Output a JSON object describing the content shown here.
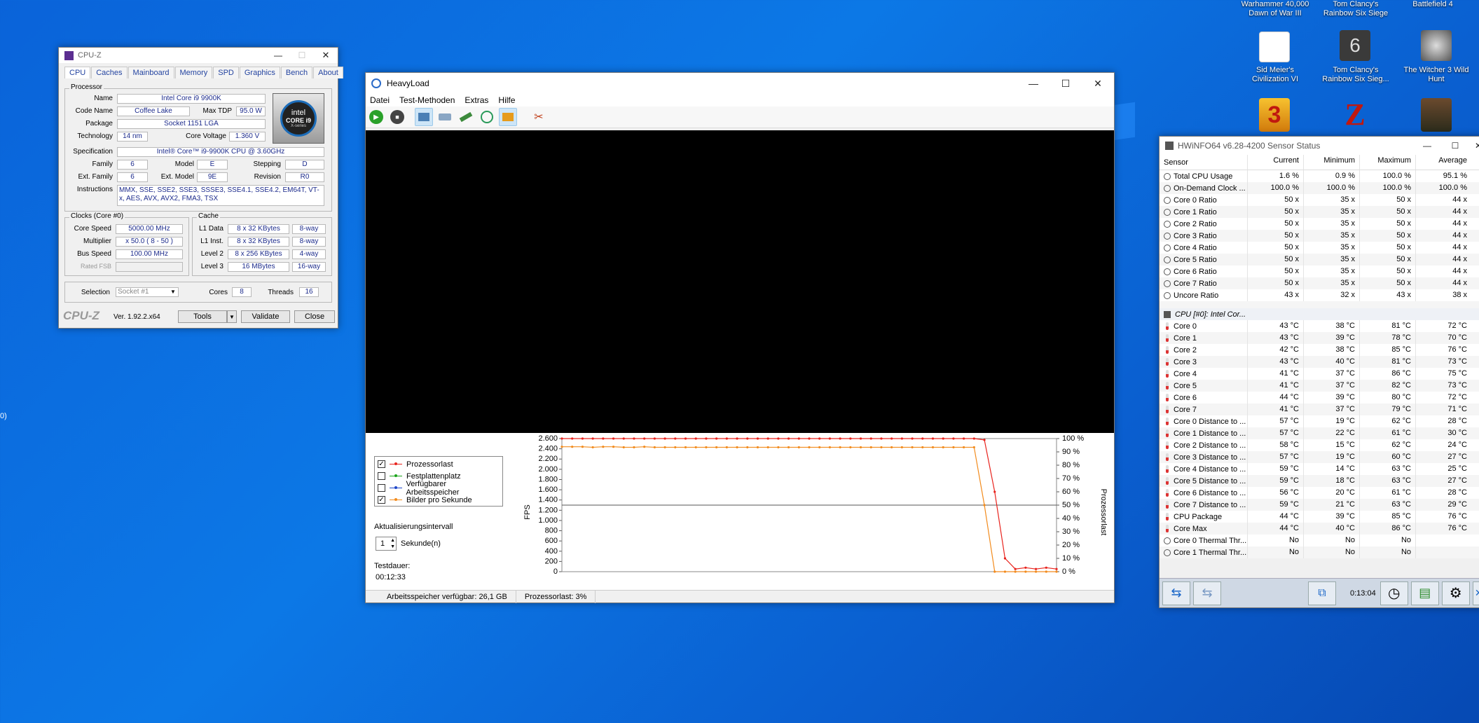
{
  "desktop": {
    "icons": [
      {
        "label_line1": "Warhammer 40,000",
        "label_line2": "Dawn of War III"
      },
      {
        "label_line1": "Tom Clancy's",
        "label_line2": "Rainbow Six Siege"
      },
      {
        "label_line1": "Battlefield 4",
        "label_line2": ""
      },
      {
        "label_line1": "Sid Meier's",
        "label_line2": "Civilization VI"
      },
      {
        "label_line1": "Tom Clancy's",
        "label_line2": "Rainbow Six Sieg..."
      },
      {
        "label_line1": "The Witcher 3 Wild",
        "label_line2": "Hunt"
      }
    ],
    "edge_text": "0)"
  },
  "cpuz": {
    "title": "CPU-Z",
    "tabs": [
      "CPU",
      "Caches",
      "Mainboard",
      "Memory",
      "SPD",
      "Graphics",
      "Bench",
      "About"
    ],
    "processor_group": "Processor",
    "labels": {
      "name": "Name",
      "code_name": "Code Name",
      "max_tdp": "Max TDP",
      "package": "Package",
      "technology": "Technology",
      "core_voltage": "Core Voltage",
      "specification": "Specification",
      "family": "Family",
      "model": "Model",
      "stepping": "Stepping",
      "ext_family": "Ext. Family",
      "ext_model": "Ext. Model",
      "revision": "Revision",
      "instructions": "Instructions"
    },
    "values": {
      "name": "Intel Core i9 9900K",
      "code_name": "Coffee Lake",
      "max_tdp": "95.0 W",
      "package": "Socket 1151 LGA",
      "technology": "14 nm",
      "core_voltage": "1.360 V",
      "specification": "Intel® Core™ i9-9900K CPU @ 3.60GHz",
      "family": "6",
      "model": "E",
      "stepping": "D",
      "ext_family": "6",
      "ext_model": "9E",
      "revision": "R0",
      "instructions": "MMX, SSE, SSE2, SSE3, SSSE3, SSE4.1, SSE4.2, EM64T, VT-x, AES, AVX, AVX2, FMA3, TSX"
    },
    "intel_logo": {
      "brand": "intel",
      "line1": "CORE i9",
      "line2": "X-series"
    },
    "clocks_group": "Clocks (Core #0)",
    "clocks": {
      "core_speed_label": "Core Speed",
      "core_speed": "5000.00 MHz",
      "multiplier_label": "Multiplier",
      "multiplier": "x 50.0 ( 8 - 50 )",
      "bus_speed_label": "Bus Speed",
      "bus_speed": "100.00 MHz",
      "rated_fsb_label": "Rated FSB",
      "rated_fsb": ""
    },
    "cache_group": "Cache",
    "cache": [
      {
        "label": "L1 Data",
        "size": "8 x 32 KBytes",
        "way": "8-way"
      },
      {
        "label": "L1 Inst.",
        "size": "8 x 32 KBytes",
        "way": "8-way"
      },
      {
        "label": "Level 2",
        "size": "8 x 256 KBytes",
        "way": "4-way"
      },
      {
        "label": "Level 3",
        "size": "16 MBytes",
        "way": "16-way"
      }
    ],
    "selection_label": "Selection",
    "selection_value": "Socket #1",
    "cores_label": "Cores",
    "cores": "8",
    "threads_label": "Threads",
    "threads": "16",
    "footer_brand": "CPU-Z",
    "version": "Ver. 1.92.2.x64",
    "tools_label": "Tools",
    "validate_label": "Validate",
    "close_label": "Close"
  },
  "heavyload": {
    "title": "HeavyLoad",
    "menu": [
      "Datei",
      "Test-Methoden",
      "Extras",
      "Hilfe"
    ],
    "legend": [
      {
        "label": "Prozessorlast",
        "checked": true,
        "color": "#e8231d"
      },
      {
        "label": "Festplattenplatz",
        "checked": false,
        "color": "#1aa31a"
      },
      {
        "label": "Verfügbarer Arbeitsspeicher",
        "checked": false,
        "color": "#1e46c8"
      },
      {
        "label": "Bilder pro Sekunde",
        "checked": true,
        "color": "#f28b1d"
      }
    ],
    "interval_label": "Aktualisierungsintervall",
    "interval_value": "1",
    "interval_unit": "Sekunde(n)",
    "duration_label": "Testdauer:",
    "duration_value": "00:12:33",
    "status": {
      "memory": "Arbeitsspeicher verfügbar: 26,1 GB",
      "cpu": "Prozessorlast: 3%"
    }
  },
  "chart_data": {
    "type": "line",
    "title": "",
    "xlabel": "",
    "ylabel": "FPS",
    "y2label": "Prozessorlast",
    "ylim": [
      0,
      2600
    ],
    "y2lim": [
      0,
      100
    ],
    "y_ticks": [
      "2.600",
      "2.400",
      "2.200",
      "2.000",
      "1.800",
      "1.600",
      "1.400",
      "1.200",
      "1.000",
      "800",
      "600",
      "400",
      "200",
      "0"
    ],
    "y2_ticks": [
      "100 %",
      "90 %",
      "80 %",
      "70 %",
      "60 %",
      "50 %",
      "40 %",
      "30 %",
      "20 %",
      "10 %",
      "0 %"
    ],
    "x": [
      0,
      1,
      2,
      3,
      4,
      5,
      6,
      7,
      8,
      9,
      10,
      11,
      12,
      13,
      14,
      15,
      16,
      17,
      18,
      19,
      20,
      21,
      22,
      23,
      24,
      25,
      26,
      27,
      28,
      29,
      30,
      31,
      32,
      33,
      34,
      35,
      36,
      37,
      38,
      39,
      40,
      41,
      42,
      43,
      44,
      45,
      46,
      47,
      48
    ],
    "series": [
      {
        "name": "Prozessorlast",
        "axis": "y2",
        "color": "#e8231d",
        "values": [
          100,
          100,
          100,
          100,
          100,
          100,
          100,
          100,
          100,
          100,
          100,
          100,
          100,
          100,
          100,
          100,
          100,
          100,
          100,
          100,
          100,
          100,
          100,
          100,
          100,
          100,
          100,
          100,
          100,
          100,
          100,
          100,
          100,
          100,
          100,
          100,
          100,
          100,
          100,
          100,
          100,
          99,
          60,
          10,
          2,
          3,
          2,
          3,
          2
        ]
      },
      {
        "name": "Bilder pro Sekunde",
        "axis": "y",
        "color": "#f28b1d",
        "values": [
          2440,
          2440,
          2440,
          2430,
          2440,
          2440,
          2430,
          2430,
          2440,
          2430,
          2430,
          2430,
          2430,
          2430,
          2430,
          2430,
          2430,
          2430,
          2430,
          2430,
          2430,
          2430,
          2430,
          2430,
          2430,
          2430,
          2430,
          2430,
          2430,
          2430,
          2430,
          2430,
          2430,
          2430,
          2430,
          2430,
          2430,
          2430,
          2430,
          2430,
          2430,
          1300,
          0,
          0,
          0,
          0,
          0,
          0,
          0
        ]
      }
    ],
    "grid": false,
    "legend": "left"
  },
  "hwinfo": {
    "title": "HWiNFO64 v6.28-4200 Sensor Status",
    "columns": [
      "Sensor",
      "Current",
      "Minimum",
      "Maximum",
      "Average"
    ],
    "rows1": [
      {
        "s": "Total CPU Usage",
        "c": "1.6 %",
        "mi": "0.9 %",
        "ma": "100.0 %",
        "av": "95.1 %"
      },
      {
        "s": "On-Demand Clock ...",
        "c": "100.0 %",
        "mi": "100.0 %",
        "ma": "100.0 %",
        "av": "100.0 %"
      },
      {
        "s": "Core 0 Ratio",
        "c": "50 x",
        "mi": "35 x",
        "ma": "50 x",
        "av": "44 x"
      },
      {
        "s": "Core 1 Ratio",
        "c": "50 x",
        "mi": "35 x",
        "ma": "50 x",
        "av": "44 x"
      },
      {
        "s": "Core 2 Ratio",
        "c": "50 x",
        "mi": "35 x",
        "ma": "50 x",
        "av": "44 x"
      },
      {
        "s": "Core 3 Ratio",
        "c": "50 x",
        "mi": "35 x",
        "ma": "50 x",
        "av": "44 x"
      },
      {
        "s": "Core 4 Ratio",
        "c": "50 x",
        "mi": "35 x",
        "ma": "50 x",
        "av": "44 x"
      },
      {
        "s": "Core 5 Ratio",
        "c": "50 x",
        "mi": "35 x",
        "ma": "50 x",
        "av": "44 x"
      },
      {
        "s": "Core 6 Ratio",
        "c": "50 x",
        "mi": "35 x",
        "ma": "50 x",
        "av": "44 x"
      },
      {
        "s": "Core 7 Ratio",
        "c": "50 x",
        "mi": "35 x",
        "ma": "50 x",
        "av": "44 x"
      },
      {
        "s": "Uncore Ratio",
        "c": "43 x",
        "mi": "32 x",
        "ma": "43 x",
        "av": "38 x"
      }
    ],
    "group2": "CPU [#0]: Intel Cor...",
    "rows2": [
      {
        "s": "Core 0",
        "c": "43 °C",
        "mi": "38 °C",
        "ma": "81 °C",
        "av": "72 °C"
      },
      {
        "s": "Core 1",
        "c": "43 °C",
        "mi": "39 °C",
        "ma": "78 °C",
        "av": "70 °C"
      },
      {
        "s": "Core 2",
        "c": "42 °C",
        "mi": "38 °C",
        "ma": "85 °C",
        "av": "76 °C"
      },
      {
        "s": "Core 3",
        "c": "43 °C",
        "mi": "40 °C",
        "ma": "81 °C",
        "av": "73 °C"
      },
      {
        "s": "Core 4",
        "c": "41 °C",
        "mi": "37 °C",
        "ma": "86 °C",
        "av": "75 °C"
      },
      {
        "s": "Core 5",
        "c": "41 °C",
        "mi": "37 °C",
        "ma": "82 °C",
        "av": "73 °C"
      },
      {
        "s": "Core 6",
        "c": "44 °C",
        "mi": "39 °C",
        "ma": "80 °C",
        "av": "72 °C"
      },
      {
        "s": "Core 7",
        "c": "41 °C",
        "mi": "37 °C",
        "ma": "79 °C",
        "av": "71 °C"
      },
      {
        "s": "Core 0 Distance to ...",
        "c": "57 °C",
        "mi": "19 °C",
        "ma": "62 °C",
        "av": "28 °C"
      },
      {
        "s": "Core 1 Distance to ...",
        "c": "57 °C",
        "mi": "22 °C",
        "ma": "61 °C",
        "av": "30 °C"
      },
      {
        "s": "Core 2 Distance to ...",
        "c": "58 °C",
        "mi": "15 °C",
        "ma": "62 °C",
        "av": "24 °C"
      },
      {
        "s": "Core 3 Distance to ...",
        "c": "57 °C",
        "mi": "19 °C",
        "ma": "60 °C",
        "av": "27 °C"
      },
      {
        "s": "Core 4 Distance to ...",
        "c": "59 °C",
        "mi": "14 °C",
        "ma": "63 °C",
        "av": "25 °C"
      },
      {
        "s": "Core 5 Distance to ...",
        "c": "59 °C",
        "mi": "18 °C",
        "ma": "63 °C",
        "av": "27 °C"
      },
      {
        "s": "Core 6 Distance to ...",
        "c": "56 °C",
        "mi": "20 °C",
        "ma": "61 °C",
        "av": "28 °C"
      },
      {
        "s": "Core 7 Distance to ...",
        "c": "59 °C",
        "mi": "21 °C",
        "ma": "63 °C",
        "av": "29 °C"
      },
      {
        "s": "CPU Package",
        "c": "44 °C",
        "mi": "39 °C",
        "ma": "85 °C",
        "av": "76 °C"
      },
      {
        "s": "Core Max",
        "c": "44 °C",
        "mi": "40 °C",
        "ma": "86 °C",
        "av": "76 °C"
      },
      {
        "s": "Core 0 Thermal Thr...",
        "c": "No",
        "mi": "No",
        "ma": "No",
        "av": ""
      },
      {
        "s": "Core 1 Thermal Thr...",
        "c": "No",
        "mi": "No",
        "ma": "No",
        "av": ""
      }
    ],
    "timer": "0:13:04"
  }
}
